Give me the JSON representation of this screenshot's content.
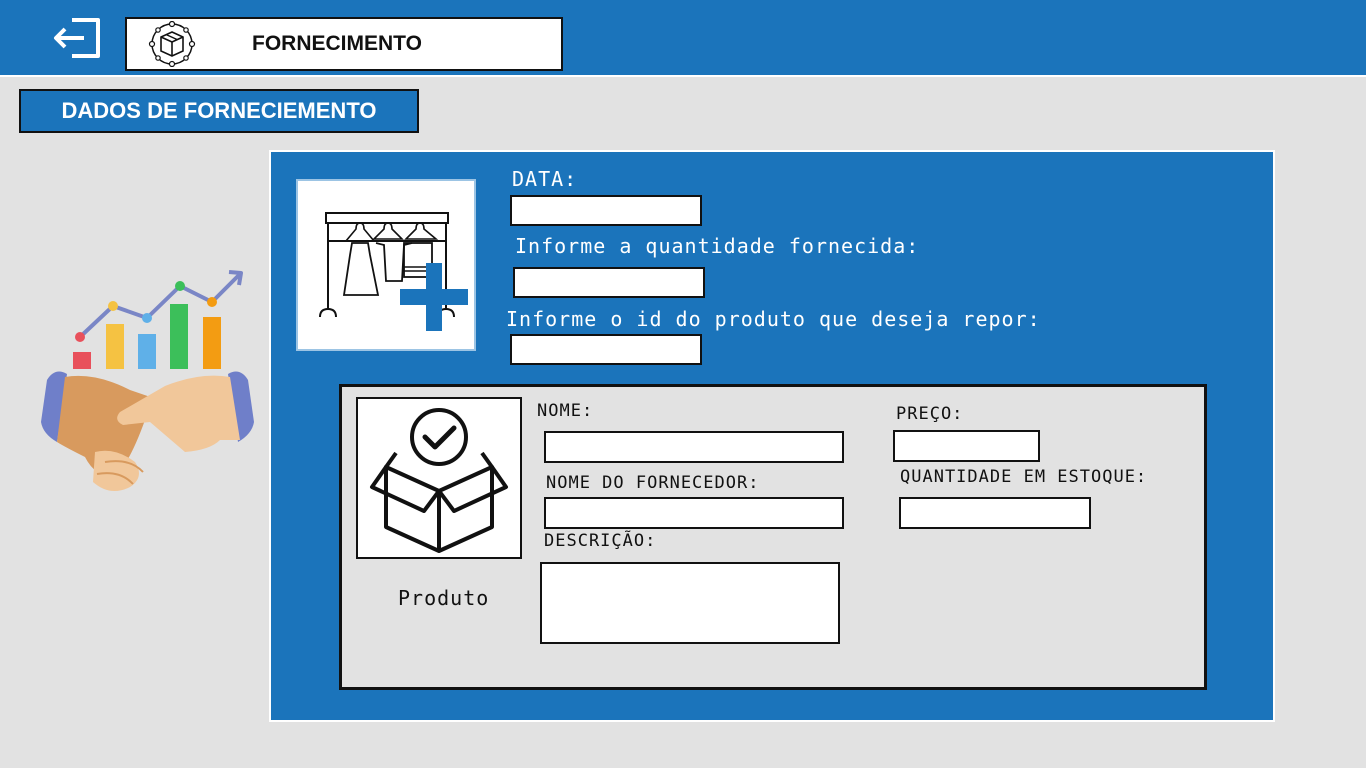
{
  "header": {
    "title": "FORNECIMENTO",
    "exit_icon": "logout-icon",
    "title_icon": "box-network-icon"
  },
  "section": {
    "title": "DADOS DE FORNECIEMENTO"
  },
  "form": {
    "data_label": "DATA:",
    "data_value": "",
    "quantidade_label": "Informe a quantidade fornecida:",
    "quantidade_value": "",
    "id_label": "Informe o id do produto que deseja repor:",
    "id_value": "",
    "rack_icon": "clothes-rack-add-icon"
  },
  "product": {
    "icon": "box-check-icon",
    "caption": "Produto",
    "nome_label": "NOME:",
    "nome_value": "",
    "fornecedor_label": "NOME DO FORNECEDOR:",
    "fornecedor_value": "",
    "descricao_label": "DESCRIÇÃO:",
    "descricao_value": "",
    "preco_label": "PREÇO:",
    "preco_value": "",
    "estoque_label": "QUANTIDADE EM ESTOQUE:",
    "estoque_value": ""
  },
  "colors": {
    "primary": "#1b74bb",
    "background": "#e2e2e2",
    "plus": "#1b74bb"
  },
  "illustration": "handshake-chart-icon"
}
